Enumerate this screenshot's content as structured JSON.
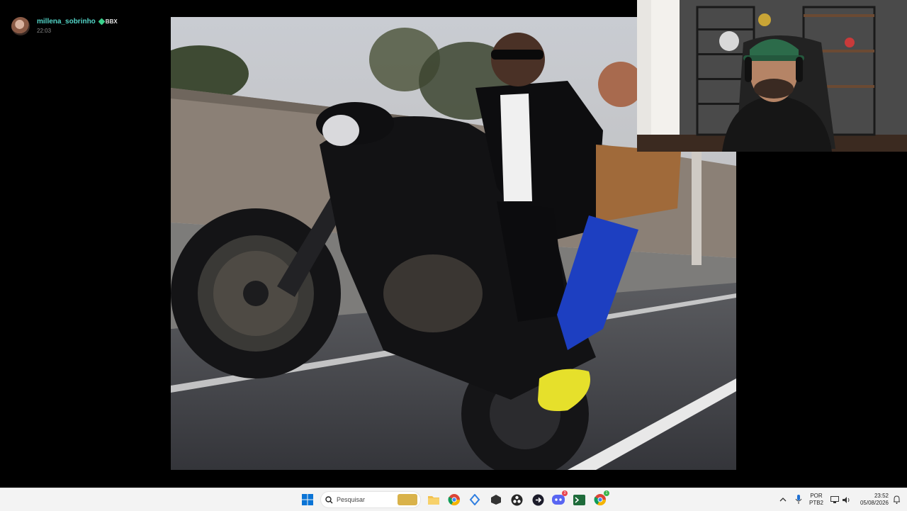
{
  "story": {
    "username": "millena_sobrinho",
    "badge": "BBX",
    "time": "22:03"
  },
  "taskbar": {
    "search_placeholder": "Pesquisar",
    "language_top": "POR",
    "language_bottom": "PTB2",
    "clock_time": "23:52",
    "clock_date": "05/08/2026",
    "discord_badge": "3",
    "chrome_badge": "1"
  },
  "colors": {
    "username": "#54d6c9",
    "badge_icon": "#3ad18b",
    "taskbar_bg": "#f3f3f3"
  }
}
